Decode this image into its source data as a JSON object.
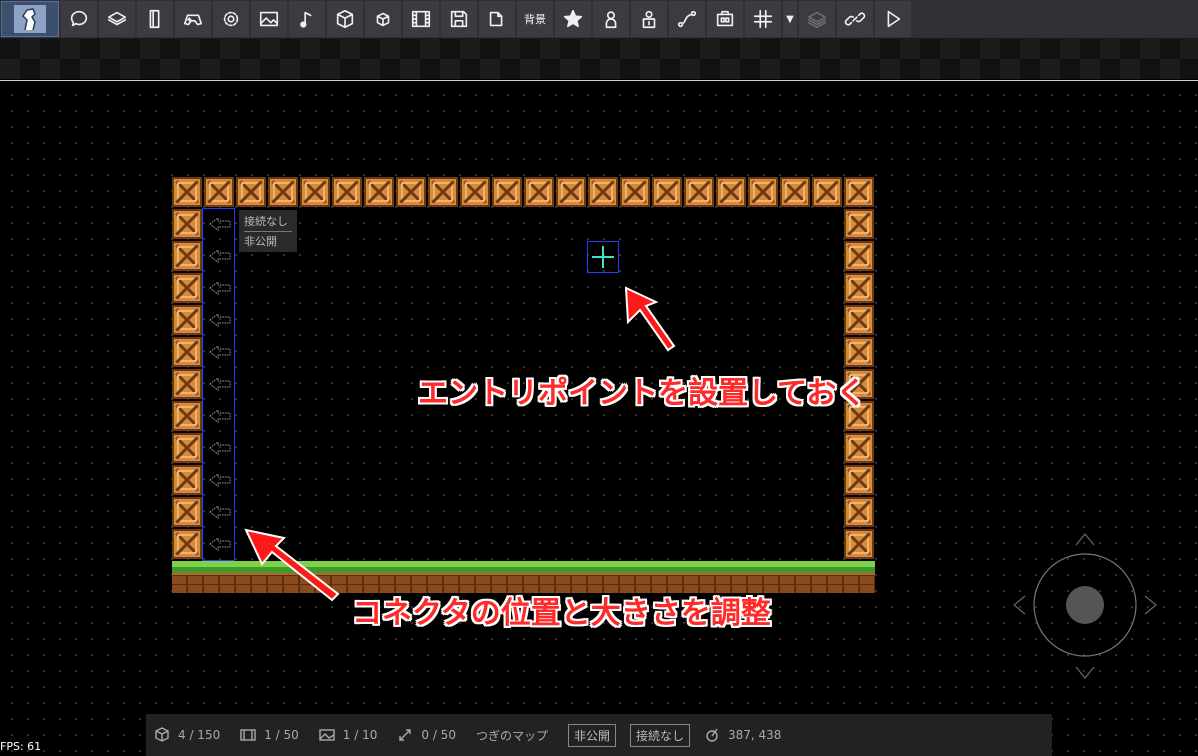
{
  "toolbar": {
    "buttons": [
      {
        "icon": "speech-bubble-icon"
      },
      {
        "icon": "layers-icon"
      },
      {
        "icon": "page-icon"
      },
      {
        "icon": "gamepad-icon"
      },
      {
        "icon": "gear-icon"
      },
      {
        "icon": "image-icon"
      },
      {
        "icon": "music-note-icon"
      },
      {
        "icon": "cube-icon"
      },
      {
        "icon": "small-cube-icon"
      },
      {
        "icon": "film-icon"
      },
      {
        "icon": "save-icon"
      },
      {
        "icon": "export-icon"
      },
      {
        "icon": "background-icon",
        "label": "背景"
      },
      {
        "icon": "star-icon"
      },
      {
        "icon": "person-icon"
      },
      {
        "icon": "lock-icon"
      },
      {
        "icon": "path-icon"
      },
      {
        "icon": "camera-icon"
      },
      {
        "icon": "grid-icon"
      },
      {
        "icon": "stack-icon"
      },
      {
        "icon": "link-icon"
      },
      {
        "icon": "play-icon"
      }
    ],
    "caret": "▼"
  },
  "connector": {
    "tooltip_line1": "接続なし",
    "tooltip_line2": "非公開"
  },
  "annotations": {
    "entry_note": "エントリポイントを設置しておく",
    "connector_note": "コネクタの位置と大きさを調整"
  },
  "status": {
    "objects": "4 / 150",
    "scenes": "1 / 50",
    "images": "1 / 10",
    "links": "0 / 50",
    "next_map": "つぎのマップ",
    "visibility": "非公開",
    "connection": "接続なし",
    "coords": "387, 438"
  },
  "fps": "FPS: 61"
}
